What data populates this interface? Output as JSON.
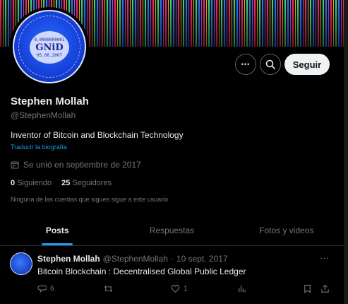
{
  "profile": {
    "avatar": {
      "serial": "0.0000000001",
      "emblem": "GNiD",
      "date": "05.08.2007"
    },
    "actions": {
      "more": "•••",
      "search": "search",
      "follow_label": "Seguir"
    },
    "name": "Stephen Mollah",
    "handle": "@StephenMollah",
    "bio": "Inventor of Bitcoin and Blockchain Technology",
    "translate_label": "Traducir la biografía",
    "joined": "Se unió en septiembre de 2017",
    "following_count": "0",
    "following_label": "Siguiendo",
    "followers_count": "25",
    "followers_label": "Seguidores",
    "mutual_note": "Ninguna de las cuentas que sigues sigue a este usuario"
  },
  "tabs": [
    {
      "label": "Posts",
      "active": true
    },
    {
      "label": "Respuestas",
      "active": false
    },
    {
      "label": "Fotos y videos",
      "active": false
    }
  ],
  "tweet": {
    "author_name": "Stephen Mollah",
    "author_handle": "@StephenMollah",
    "separator": "·",
    "date": "10 sept. 2017",
    "more": "···",
    "text": "Bitcoin Blockchain : Decentralised Global Public Ledger",
    "replies": "6",
    "retweets": "",
    "likes": "1"
  },
  "colors": {
    "accent": "#1d9bf0",
    "background": "#000000",
    "muted": "#71767b"
  }
}
